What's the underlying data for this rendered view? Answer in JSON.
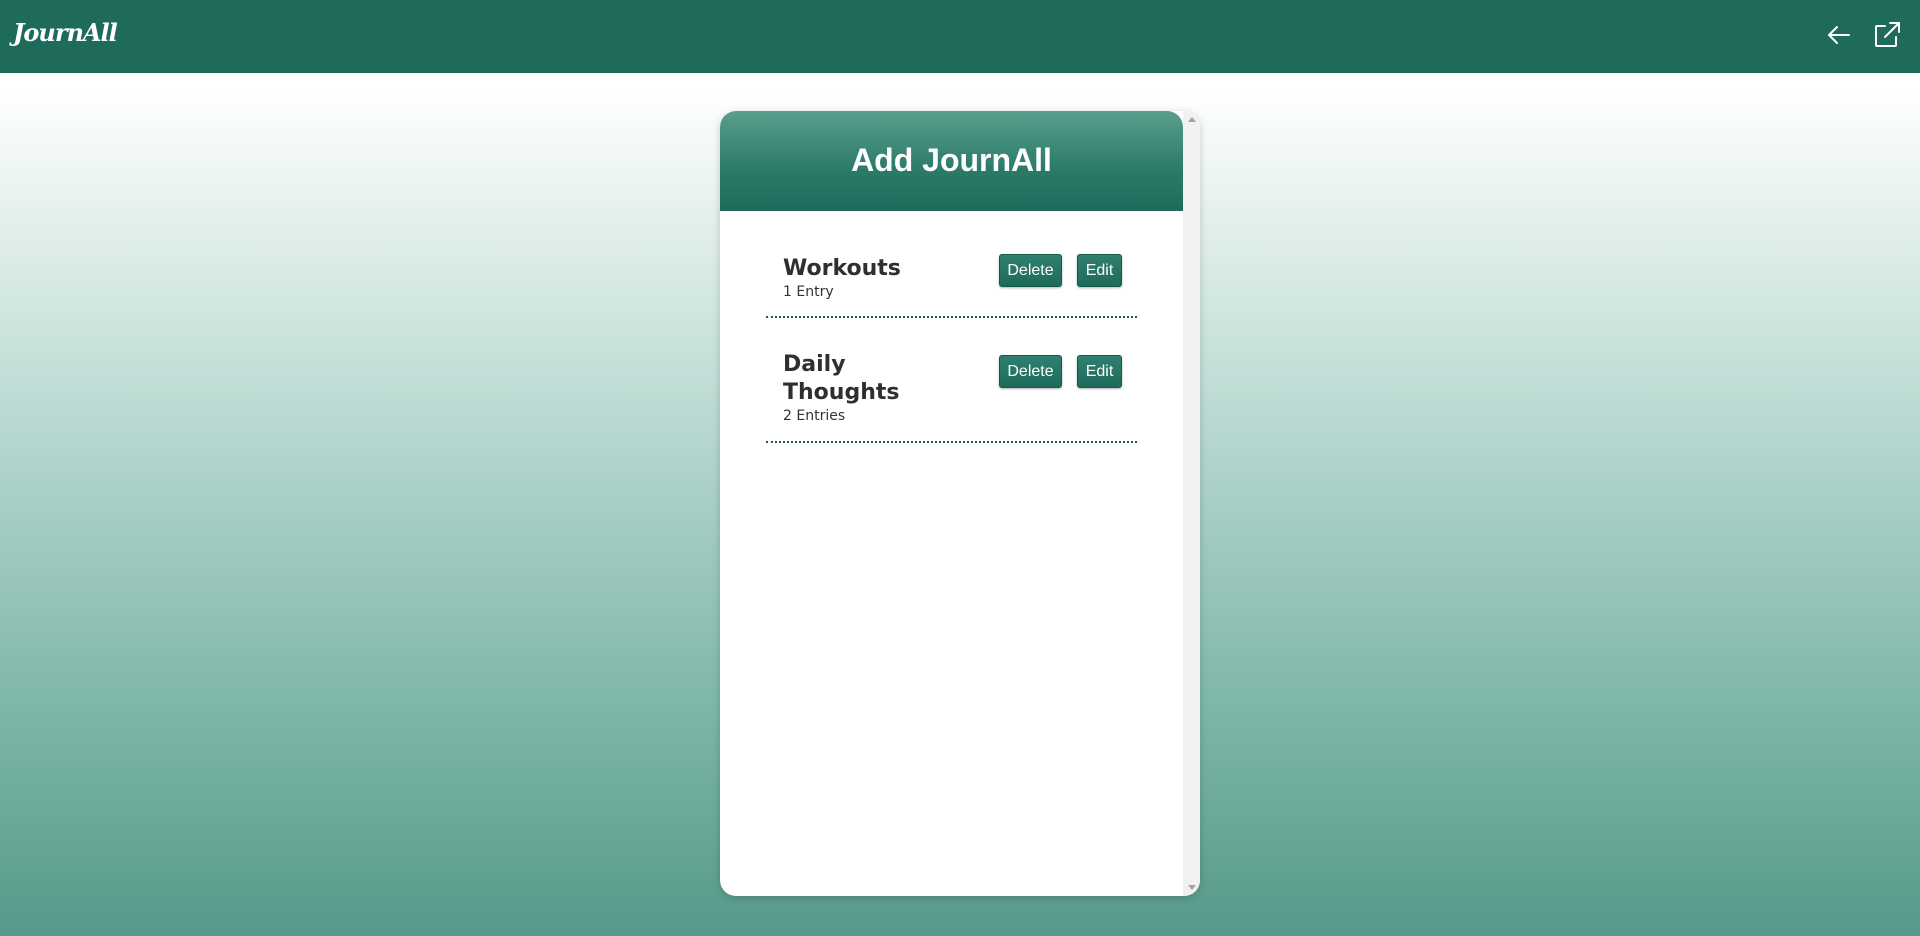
{
  "app": {
    "logo": "JournAll"
  },
  "topbar": {
    "icons": [
      "arrow-left-icon",
      "external-link-icon"
    ]
  },
  "panel": {
    "title": "Add JournAll",
    "journals": [
      {
        "name": "Workouts",
        "count": "1 Entry",
        "delete_label": "Delete",
        "edit_label": "Edit"
      },
      {
        "name": "Daily Thoughts",
        "count": "2 Entries",
        "delete_label": "Delete",
        "edit_label": "Edit"
      }
    ]
  },
  "colors": {
    "brand": "#1e6b5c",
    "button": "#2a7a69",
    "divider": "#1e5a4d"
  }
}
